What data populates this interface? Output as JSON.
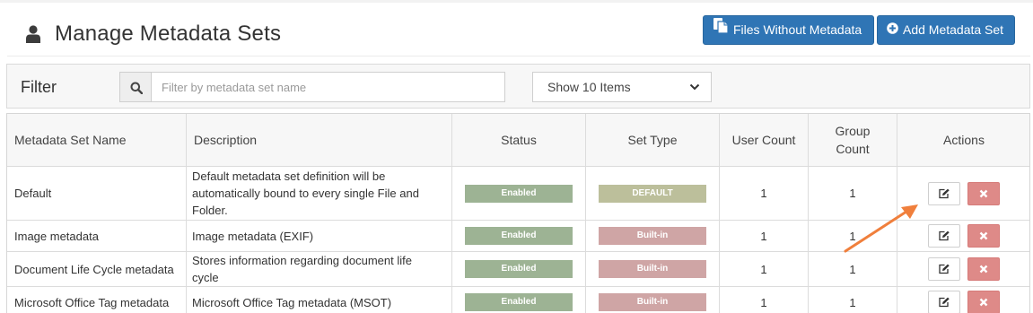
{
  "header": {
    "title": "Manage Metadata Sets",
    "user_icon": "user-icon",
    "buttons": {
      "files_without_metadata": "Files Without Metadata",
      "files_icon": "files-icon",
      "add_metadata_set": "Add Metadata Set",
      "add_icon": "plus-circle-icon"
    }
  },
  "filter": {
    "label": "Filter",
    "search_icon": "search-icon",
    "search_placeholder": "Filter by metadata set name",
    "search_value": "",
    "page_size_selected": "Show 10 Items"
  },
  "table": {
    "columns": {
      "name": "Metadata Set Name",
      "description": "Description",
      "status": "Status",
      "set_type": "Set Type",
      "user_count": "User Count",
      "group_count": "Group Count",
      "actions": "Actions"
    },
    "rows": [
      {
        "name": "Default",
        "description": "Default metadata set definition will be automatically bound to every single File and Folder.",
        "status": "Enabled",
        "set_type": "DEFAULT",
        "user_count": "1",
        "group_count": "1"
      },
      {
        "name": "Image metadata",
        "description": "Image metadata (EXIF)",
        "status": "Enabled",
        "set_type": "Built-in",
        "user_count": "1",
        "group_count": "1"
      },
      {
        "name": "Document Life Cycle metadata",
        "description": "Stores information regarding document life cycle",
        "status": "Enabled",
        "set_type": "Built-in",
        "user_count": "1",
        "group_count": "1"
      },
      {
        "name": "Microsoft Office Tag metadata",
        "description": "Microsoft Office Tag metadata (MSOT)",
        "status": "Enabled",
        "set_type": "Built-in",
        "user_count": "1",
        "group_count": "1"
      }
    ],
    "action_icons": {
      "edit": "edit-icon",
      "delete": "close-icon"
    }
  },
  "colors": {
    "primary_button": "#2f75b5",
    "enabled_badge": "#9db394",
    "default_badge": "#bcbf9b",
    "builtin_badge": "#cfa5a5",
    "delete_button": "#de8a88",
    "annotation_arrow": "#f07f3c"
  },
  "annotation": {
    "arrow_icon": "arrow-annotation-icon"
  }
}
